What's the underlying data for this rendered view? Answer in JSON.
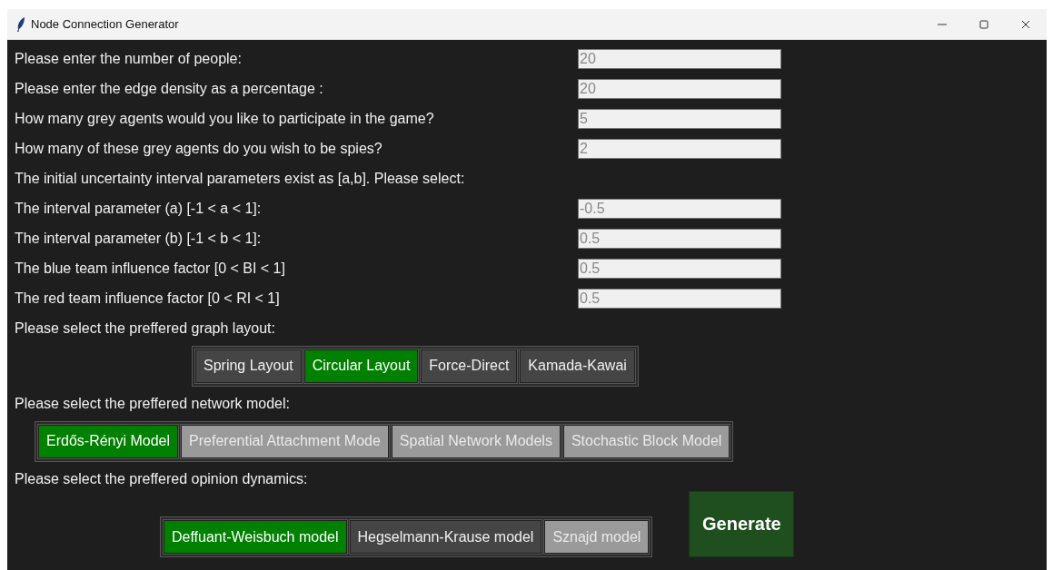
{
  "window": {
    "title": "Node Connection Generator"
  },
  "fields": [
    {
      "label": "Please enter the number of people:",
      "value": "20"
    },
    {
      "label": "Please enter the edge density as a percentage :",
      "value": "20"
    },
    {
      "label": "How many grey agents would you like to participate in the game?",
      "value": "5"
    },
    {
      "label": "How many of these grey agents do you wish to be spies?",
      "value": "2"
    },
    {
      "label": "The initial uncertainty interval parameters exist as [a,b]. Please select:"
    },
    {
      "label": "The interval parameter (a) [-1 < a < 1]:",
      "value": "-0.5"
    },
    {
      "label": "The interval parameter (b) [-1 < b < 1]:",
      "value": "0.5"
    },
    {
      "label": "The blue team influence factor [0 < BI < 1]",
      "value": "0.5"
    },
    {
      "label": "The red team influence factor [0 < RI < 1]",
      "value": "0.5"
    }
  ],
  "graph_layout": {
    "label": "Please select the preffered graph layout:",
    "options": [
      {
        "label": "Spring Layout",
        "selected": false,
        "disabled": false
      },
      {
        "label": "Circular Layout",
        "selected": true,
        "disabled": false
      },
      {
        "label": "Force-Direct",
        "selected": false,
        "disabled": false
      },
      {
        "label": "Kamada-Kawai",
        "selected": false,
        "disabled": false
      }
    ]
  },
  "network_model": {
    "label": "Please select the preffered network model:",
    "options": [
      {
        "label": "Erdős-Rényi Model",
        "selected": true,
        "disabled": false
      },
      {
        "label": "Preferential Attachment Mode",
        "selected": false,
        "disabled": true
      },
      {
        "label": "Spatial Network Models",
        "selected": false,
        "disabled": true
      },
      {
        "label": "Stochastic Block Model",
        "selected": false,
        "disabled": true
      }
    ]
  },
  "opinion_dynamics": {
    "label": "Please select the preffered opinion dynamics:",
    "options": [
      {
        "label": "Deffuant-Weisbuch model",
        "selected": true,
        "disabled": false
      },
      {
        "label": "Hegselmann-Krause model",
        "selected": false,
        "disabled": false
      },
      {
        "label": "Sznajd model",
        "selected": false,
        "disabled": true
      }
    ]
  },
  "generate_button": "Generate"
}
